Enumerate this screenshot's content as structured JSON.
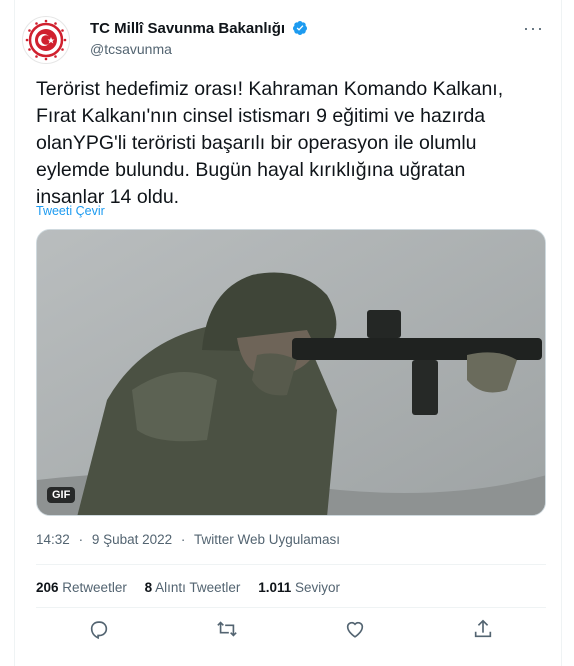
{
  "account": {
    "name": "TC Millî Savunma Bakanlığı",
    "handle": "@tcsavunma",
    "avatar_icon": "turkish-mod-emblem",
    "verified_color": "#1d9bf0"
  },
  "tweet": {
    "text": "Terörist hedefimiz orası! Kahraman Komando Kalkanı,\nFırat Kalkanı'nın cinsel istismarı 9 eğitimi ve hazırda\nolanYPG'li teröristi başarılı bir operasyon ile olumlu\neylemde bulundu. Bugün hayal kırıklığına uğratan\ninsanlar 14 oldu.",
    "translate_label": "Tweeti Çevir",
    "media_badge": "GIF"
  },
  "meta": {
    "time": "14:32",
    "date": "9 Şubat 2022",
    "source": "Twitter Web Uygulaması",
    "separator": "·"
  },
  "stats": {
    "retweets_count": "206",
    "retweets_label": "Retweetler",
    "quotes_count": "8",
    "quotes_label": "Alıntı Tweetler",
    "likes_count": "1.011",
    "likes_label": "Seviyor"
  },
  "actions": [
    "reply-icon",
    "retweet-icon",
    "like-icon",
    "share-icon"
  ],
  "colors": {
    "accent": "#1d9bf0",
    "muted": "#536471",
    "text": "#0f1419",
    "emblem_red": "#d0202e"
  }
}
